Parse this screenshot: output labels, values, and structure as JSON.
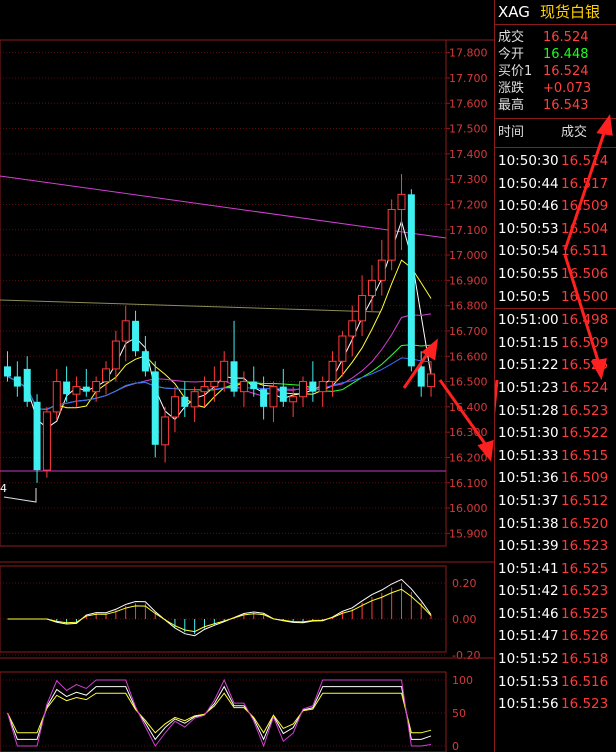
{
  "symbol": "XAG",
  "name": "现货白银",
  "quote": [
    {
      "label": "成交",
      "value": "16.524",
      "color": "#ff4040"
    },
    {
      "label": "今开",
      "value": "16.448",
      "color": "#1dff1d"
    },
    {
      "label": "买价1",
      "value": "16.524",
      "color": "#ff4040"
    },
    {
      "label": "涨跌",
      "value": "+0.073",
      "color": "#ff4040"
    },
    {
      "label": "最高",
      "value": "16.543",
      "color": "#ff4040"
    }
  ],
  "ticks_header": {
    "time": "时间",
    "price": "成交"
  },
  "ticks": [
    {
      "time": "10:50:30",
      "price": "16.514"
    },
    {
      "time": "10:50:44",
      "price": "16.517"
    },
    {
      "time": "10:50:46",
      "price": "16.509"
    },
    {
      "time": "10:50:53",
      "price": "16.504"
    },
    {
      "time": "10:50:54",
      "price": "16.511"
    },
    {
      "time": "10:50:55",
      "price": "16.506"
    },
    {
      "time": "10:50:5",
      "price": "16.500"
    },
    {
      "time": "10:51:00",
      "price": "16.498"
    },
    {
      "time": "10:51:15",
      "price": "16.509"
    },
    {
      "time": "10:51:22",
      "price": "16.525"
    },
    {
      "time": "10:51:23",
      "price": "16.524"
    },
    {
      "time": "10:51:28",
      "price": "16.523"
    },
    {
      "time": "10:51:30",
      "price": "16.522"
    },
    {
      "time": "10:51:33",
      "price": "16.515"
    },
    {
      "time": "10:51:36",
      "price": "16.509"
    },
    {
      "time": "10:51:37",
      "price": "16.512"
    },
    {
      "time": "10:51:38",
      "price": "16.520"
    },
    {
      "time": "10:51:39",
      "price": "16.523"
    },
    {
      "time": "10:51:41",
      "price": "16.525"
    },
    {
      "time": "10:51:42",
      "price": "16.523"
    },
    {
      "time": "10:51:46",
      "price": "16.525"
    },
    {
      "time": "10:51:47",
      "price": "16.526"
    },
    {
      "time": "10:51:52",
      "price": "16.518"
    },
    {
      "time": "10:51:53",
      "price": "16.516"
    },
    {
      "time": "10:51:56",
      "price": "16.523"
    }
  ],
  "chart_data": {
    "type": "candlestick",
    "price_axis_ticks": [
      "17.800",
      "17.700",
      "17.600",
      "17.500",
      "17.400",
      "17.300",
      "17.200",
      "17.100",
      "17.000",
      "16.900",
      "16.800",
      "16.700",
      "16.600",
      "16.500",
      "16.400",
      "16.300",
      "16.200",
      "16.100",
      "16.000",
      "15.900"
    ],
    "low_label": "4",
    "macd_axis_ticks": [
      "0.20",
      "0.00",
      "-0.20"
    ],
    "kdj_axis_ticks": [
      "100",
      "50",
      "0"
    ],
    "candles": [
      {
        "o": 16.56,
        "h": 16.62,
        "l": 16.5,
        "c": 16.52
      },
      {
        "o": 16.52,
        "h": 16.58,
        "l": 16.44,
        "c": 16.48
      },
      {
        "o": 16.55,
        "h": 16.6,
        "l": 16.4,
        "c": 16.42
      },
      {
        "o": 16.42,
        "h": 16.45,
        "l": 16.1,
        "c": 16.15
      },
      {
        "o": 16.15,
        "h": 16.4,
        "l": 16.12,
        "c": 16.38
      },
      {
        "o": 16.38,
        "h": 16.55,
        "l": 16.35,
        "c": 16.5
      },
      {
        "o": 16.5,
        "h": 16.56,
        "l": 16.42,
        "c": 16.45
      },
      {
        "o": 16.45,
        "h": 16.52,
        "l": 16.4,
        "c": 16.48
      },
      {
        "o": 16.48,
        "h": 16.55,
        "l": 16.44,
        "c": 16.46
      },
      {
        "o": 16.46,
        "h": 16.52,
        "l": 16.42,
        "c": 16.5
      },
      {
        "o": 16.5,
        "h": 16.58,
        "l": 16.45,
        "c": 16.55
      },
      {
        "o": 16.55,
        "h": 16.7,
        "l": 16.5,
        "c": 16.66
      },
      {
        "o": 16.66,
        "h": 16.8,
        "l": 16.58,
        "c": 16.74
      },
      {
        "o": 16.74,
        "h": 16.78,
        "l": 16.6,
        "c": 16.62
      },
      {
        "o": 16.62,
        "h": 16.68,
        "l": 16.52,
        "c": 16.54
      },
      {
        "o": 16.54,
        "h": 16.58,
        "l": 16.2,
        "c": 16.25
      },
      {
        "o": 16.25,
        "h": 16.4,
        "l": 16.18,
        "c": 16.36
      },
      {
        "o": 16.36,
        "h": 16.48,
        "l": 16.3,
        "c": 16.44
      },
      {
        "o": 16.44,
        "h": 16.5,
        "l": 16.36,
        "c": 16.4
      },
      {
        "o": 16.4,
        "h": 16.48,
        "l": 16.34,
        "c": 16.46
      },
      {
        "o": 16.46,
        "h": 16.52,
        "l": 16.4,
        "c": 16.48
      },
      {
        "o": 16.48,
        "h": 16.56,
        "l": 16.42,
        "c": 16.5
      },
      {
        "o": 16.5,
        "h": 16.62,
        "l": 16.46,
        "c": 16.58
      },
      {
        "o": 16.58,
        "h": 16.74,
        "l": 16.44,
        "c": 16.46
      },
      {
        "o": 16.46,
        "h": 16.54,
        "l": 16.4,
        "c": 16.5
      },
      {
        "o": 16.5,
        "h": 16.56,
        "l": 16.44,
        "c": 16.47
      },
      {
        "o": 16.47,
        "h": 16.52,
        "l": 16.35,
        "c": 16.4
      },
      {
        "o": 16.4,
        "h": 16.5,
        "l": 16.34,
        "c": 16.48
      },
      {
        "o": 16.48,
        "h": 16.55,
        "l": 16.4,
        "c": 16.42
      },
      {
        "o": 16.42,
        "h": 16.48,
        "l": 16.36,
        "c": 16.44
      },
      {
        "o": 16.44,
        "h": 16.52,
        "l": 16.4,
        "c": 16.5
      },
      {
        "o": 16.5,
        "h": 16.58,
        "l": 16.42,
        "c": 16.46
      },
      {
        "o": 16.46,
        "h": 16.52,
        "l": 16.4,
        "c": 16.5
      },
      {
        "o": 16.5,
        "h": 16.62,
        "l": 16.44,
        "c": 16.58
      },
      {
        "o": 16.58,
        "h": 16.7,
        "l": 16.52,
        "c": 16.68
      },
      {
        "o": 16.68,
        "h": 16.8,
        "l": 16.6,
        "c": 16.74
      },
      {
        "o": 16.74,
        "h": 16.92,
        "l": 16.68,
        "c": 16.84
      },
      {
        "o": 16.84,
        "h": 16.96,
        "l": 16.78,
        "c": 16.9
      },
      {
        "o": 16.9,
        "h": 17.06,
        "l": 16.84,
        "c": 16.98
      },
      {
        "o": 16.98,
        "h": 17.22,
        "l": 16.94,
        "c": 17.18
      },
      {
        "o": 17.18,
        "h": 17.32,
        "l": 17.02,
        "c": 17.24
      },
      {
        "o": 17.24,
        "h": 17.26,
        "l": 16.54,
        "c": 16.56
      },
      {
        "o": 16.56,
        "h": 16.62,
        "l": 16.44,
        "c": 16.48
      },
      {
        "o": 16.48,
        "h": 16.58,
        "l": 16.44,
        "c": 16.53
      }
    ]
  }
}
